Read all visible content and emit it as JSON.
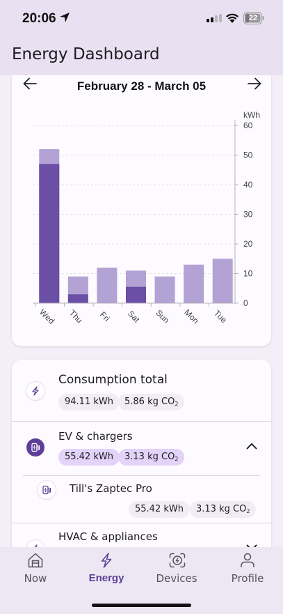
{
  "status_bar": {
    "time": "20:06",
    "battery": "22"
  },
  "header": {
    "title": "Energy Dashboard"
  },
  "chart_nav": {
    "date_range": "February 28 - March 05"
  },
  "chart_data": {
    "type": "bar",
    "categories": [
      "Wed",
      "Thu",
      "Fri",
      "Sat",
      "Sun",
      "Mon",
      "Tue"
    ],
    "series": [
      {
        "values": [
          47,
          3,
          0,
          5.5,
          0,
          0,
          0
        ]
      },
      {
        "values": [
          52,
          9,
          12,
          11,
          9,
          13,
          15
        ]
      }
    ],
    "ylabel": "kWh",
    "ylim": [
      0,
      60
    ],
    "yticks": [
      "0",
      "10",
      "20",
      "30",
      "40",
      "50",
      "60"
    ],
    "stacking": "overlay",
    "grid": "dashed horizontal",
    "colors": [
      "#6b4ea6",
      "#b3a2d4"
    ]
  },
  "consumption": {
    "total": {
      "title": "Consumption total",
      "energy": "94.11 kWh",
      "co2": "5.86 kg CO",
      "co2_sub": "2"
    },
    "ev": {
      "title": "EV & chargers",
      "energy": "55.42 kWh",
      "co2": "3.13 kg CO",
      "co2_sub": "2"
    },
    "charger": {
      "title": "Till's Zaptec Pro",
      "energy": "55.42 kWh",
      "co2": "3.13 kg CO",
      "co2_sub": "2"
    },
    "hvac": {
      "title": "HVAC & appliances"
    }
  },
  "bottom_nav": {
    "items": [
      {
        "label": "Now"
      },
      {
        "label": "Energy"
      },
      {
        "label": "Devices"
      },
      {
        "label": "Profile"
      }
    ]
  },
  "colors": {
    "accent": "#5e3f97",
    "bar_dark": "#6b4ea6",
    "bar_light": "#b3a2d4",
    "chip_accent": "#e3d3f8"
  }
}
